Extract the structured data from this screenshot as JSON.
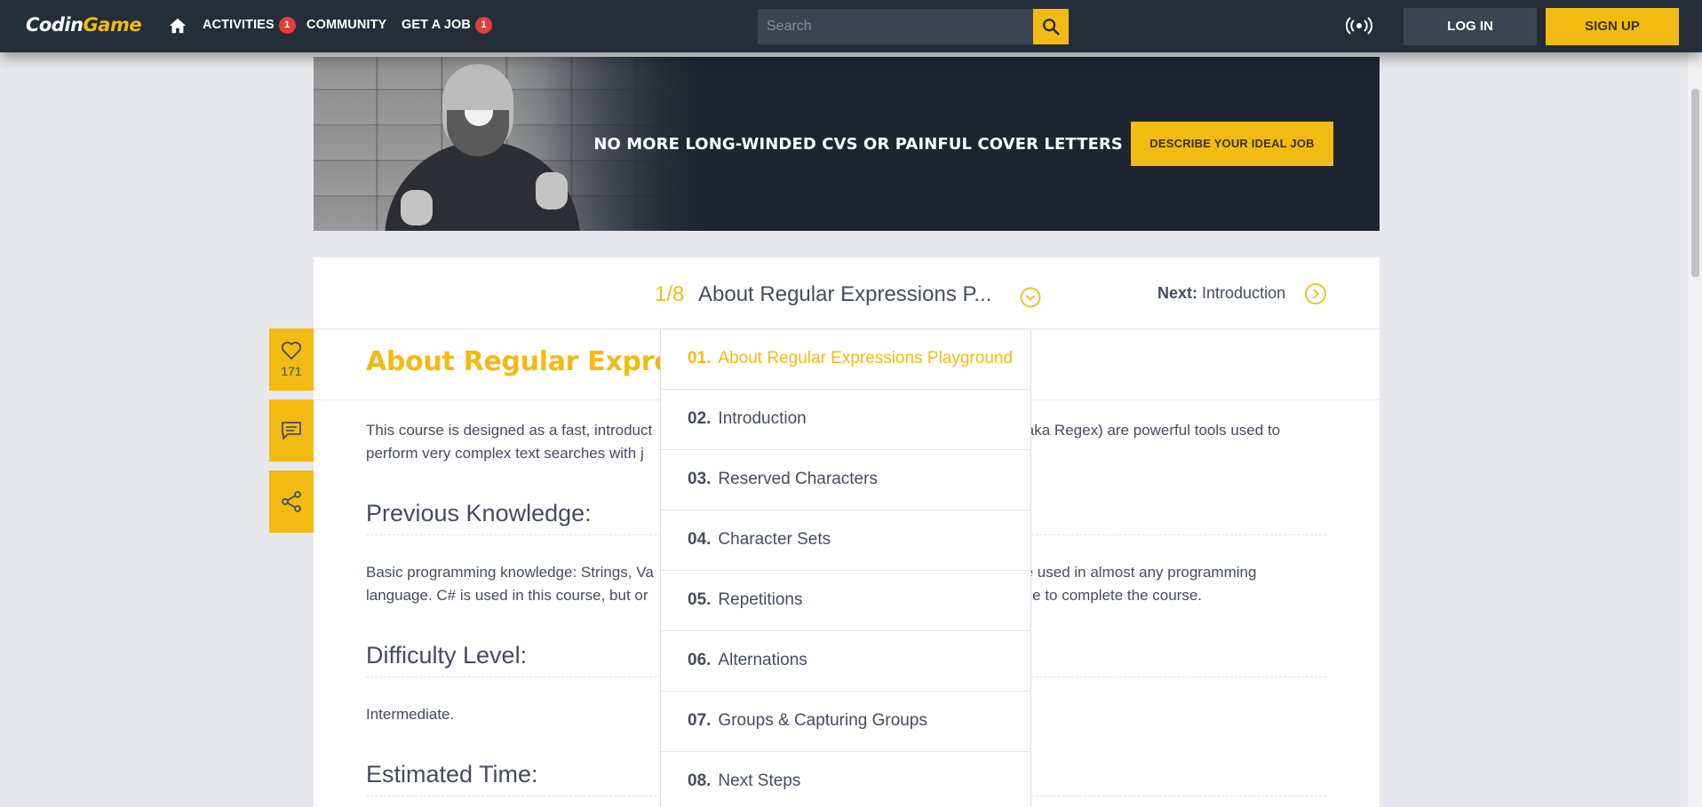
{
  "nav": {
    "logo_main": "Codin",
    "logo_accent": "Game",
    "activities_label": "ACTIVITIES",
    "activities_badge": "1",
    "community_label": "COMMUNITY",
    "jobs_label": "GET A JOB",
    "jobs_badge": "1",
    "search_placeholder": "Search",
    "login_label": "LOG IN",
    "signup_label": "SIGN UP"
  },
  "banner": {
    "headline": "NO MORE LONG-WINDED CVS OR PAINFUL COVER LETTERS",
    "cta_label": "DESCRIBE YOUR IDEAL JOB"
  },
  "course": {
    "step_counter": "1/8",
    "step_title": "About Regular Expressions P...",
    "next_prefix": "Next:",
    "next_title": "Introduction",
    "title": "About Regular Expressi",
    "likes": "171",
    "intro_text_1": "This course is designed as a fast, introduct",
    "intro_text_1b": "ons (aka Regex) are powerful tools used to",
    "intro_text_2": "perform very complex text searches with j",
    "previous_knowledge_heading": "Previous Knowledge:",
    "previous_knowledge_1": "Basic programming knowledge: Strings, Va",
    "previous_knowledge_1b": "n be used in almost any programming",
    "previous_knowledge_2": "language. C# is used in this course, but or",
    "previous_knowledge_2b": "ledge to complete the course.",
    "difficulty_heading": "Difficulty Level:",
    "difficulty_value": "Intermediate.",
    "time_heading": "Estimated Time:"
  },
  "dropdown": {
    "items": [
      {
        "num": "01.",
        "label": "About Regular Expressions Playground",
        "active": true
      },
      {
        "num": "02.",
        "label": "Introduction",
        "active": false
      },
      {
        "num": "03.",
        "label": "Reserved Characters",
        "active": false
      },
      {
        "num": "04.",
        "label": "Character Sets",
        "active": false
      },
      {
        "num": "05.",
        "label": "Repetitions",
        "active": false
      },
      {
        "num": "06.",
        "label": "Alternations",
        "active": false
      },
      {
        "num": "07.",
        "label": "Groups & Capturing Groups",
        "active": false
      },
      {
        "num": "08.",
        "label": "Next Steps",
        "active": false
      }
    ]
  },
  "colors": {
    "accent": "#f2bb13",
    "navbar": "#252e38",
    "badge": "#e23e39",
    "text": "#454c5e"
  }
}
